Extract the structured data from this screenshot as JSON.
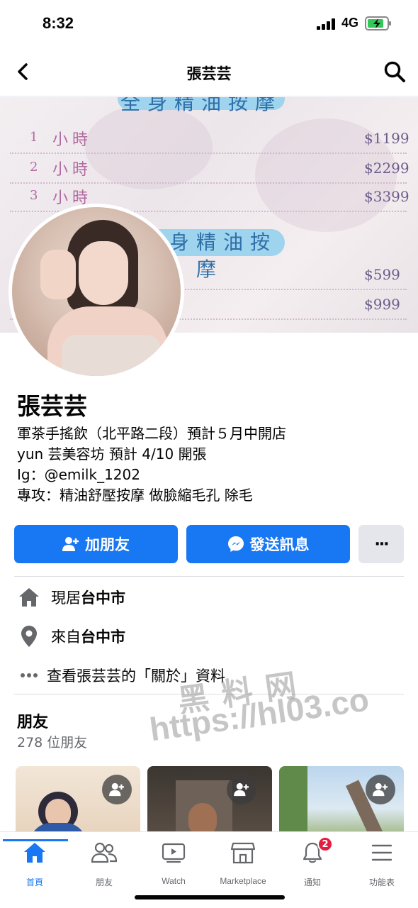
{
  "status": {
    "time": "8:32",
    "network": "4G"
  },
  "navbar": {
    "title": "張芸芸"
  },
  "cover": {
    "banner_top": "全身精油按摩",
    "banner_mid": "半身精油按摩",
    "rows": [
      {
        "num": "1",
        "label": "小時",
        "price": "$1199"
      },
      {
        "num": "2",
        "label": "小時",
        "price": "$2299"
      },
      {
        "num": "3",
        "label": "小時",
        "price": "$3399"
      },
      {
        "num": "",
        "label": "",
        "price": "$599"
      },
      {
        "num": "",
        "label": "",
        "price": "$999"
      }
    ]
  },
  "profile": {
    "name": "張芸芸",
    "bio": [
      "軍茶手搖飲（北平路二段）預計５月中開店",
      "yun 芸美容坊 預計 4/10 開張",
      "Ig：@emilk_1202",
      "專攻：精油舒壓按摩 做臉縮毛孔 除毛"
    ]
  },
  "actions": {
    "add_friend": "加朋友",
    "message": "發送訊息",
    "more": "···"
  },
  "info": {
    "lives_prefix": "現居",
    "lives_city": "台中市",
    "from_prefix": "來自",
    "from_city": "台中市",
    "about": "查看張芸芸的「關於」資料"
  },
  "friends": {
    "title": "朋友",
    "count": "278 位朋友"
  },
  "watermark": {
    "line1": "黑料网",
    "line2": "https://hl03.co"
  },
  "tabs": [
    {
      "label": "首頁",
      "icon": "home-icon",
      "active": true
    },
    {
      "label": "朋友",
      "icon": "friends-icon",
      "active": false
    },
    {
      "label": "Watch",
      "icon": "watch-icon",
      "active": false
    },
    {
      "label": "Marketplace",
      "icon": "marketplace-icon",
      "active": false
    },
    {
      "label": "通知",
      "icon": "bell-icon",
      "active": false,
      "badge": "2"
    },
    {
      "label": "功能表",
      "icon": "menu-icon",
      "active": false
    }
  ],
  "colors": {
    "accent": "#1877f2",
    "badge": "#e41e3f",
    "secondary_button": "#e4e6eb"
  }
}
